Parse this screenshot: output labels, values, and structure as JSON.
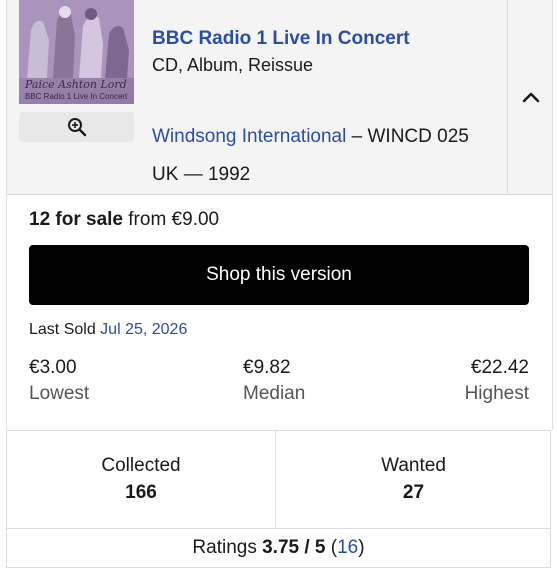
{
  "release": {
    "cover": {
      "artist_text": "Paice Ashton Lord",
      "subtitle_text": "BBC Radio 1 Live In Concert"
    },
    "title": "BBC Radio 1 Live In Concert",
    "formats": "CD, Album, Reissue",
    "label": "Windsong International",
    "separator": "–",
    "catalog_number": "WINCD 025",
    "country": "UK",
    "dash": "—",
    "year": "1992",
    "icons": {
      "zoom": "zoom-in-icon",
      "collapse": "chevron-up-icon"
    }
  },
  "sale": {
    "count_text": "12 for sale",
    "from_text": "from €9.00",
    "shop_button": "Shop this version",
    "last_sold_label": "Last Sold",
    "last_sold_date": "Jul 25, 2026",
    "lowest_value": "€3.00",
    "lowest_label": "Lowest",
    "median_value": "€9.82",
    "median_label": "Median",
    "highest_value": "€22.42",
    "highest_label": "Highest"
  },
  "community": {
    "collected_label": "Collected",
    "collected_count": "166",
    "wanted_label": "Wanted",
    "wanted_count": "27"
  },
  "ratings": {
    "label": "Ratings",
    "average": "3.75",
    "scale_text": "/ 5",
    "open_paren": "(",
    "count": "16",
    "close_paren": ")"
  },
  "colors": {
    "link": "#2a4ea5",
    "button_bg": "#000000",
    "button_text": "#ffffff",
    "card_bg": "#f4f4f4"
  }
}
